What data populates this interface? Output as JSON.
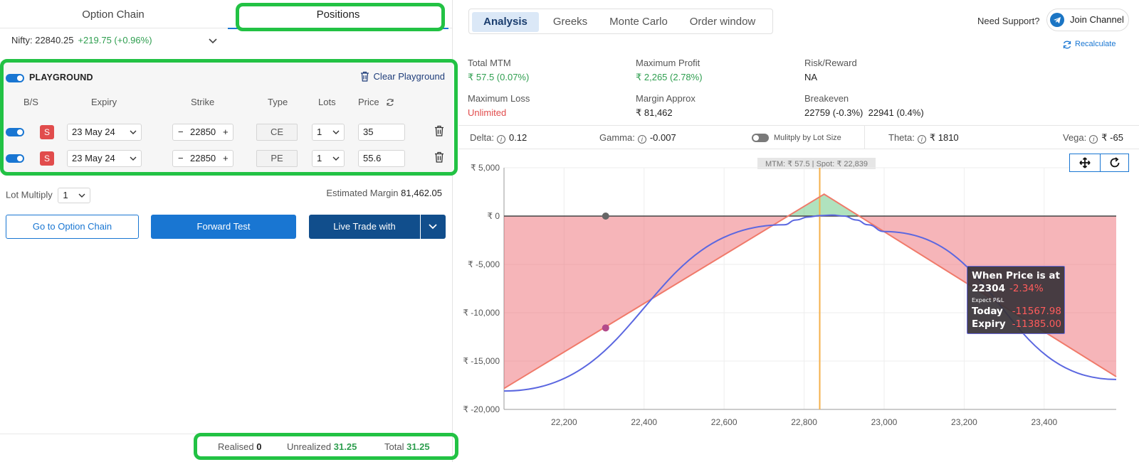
{
  "left_tabs": {
    "option_chain": "Option Chain",
    "positions": "Positions"
  },
  "nifty": {
    "label": "Nifty: 22840.25",
    "change": "+219.75 (+0.96%)"
  },
  "playground": {
    "title": "PLAYGROUND",
    "clear_label": "Clear Playground",
    "headers": {
      "bs": "B/S",
      "expiry": "Expiry",
      "strike": "Strike",
      "type": "Type",
      "lots": "Lots",
      "price": "Price"
    },
    "rows": [
      {
        "side": "S",
        "expiry": "23 May 24",
        "strike": "22850",
        "type": "CE",
        "lots": "1",
        "price": "35"
      },
      {
        "side": "S",
        "expiry": "23 May 24",
        "strike": "22850",
        "type": "PE",
        "lots": "1",
        "price": "55.6"
      }
    ]
  },
  "lot_multiply": {
    "label": "Lot Multiply",
    "value": "1"
  },
  "estimated_margin": {
    "label": "Estimated Margin",
    "value": "81,462.05"
  },
  "buttons": {
    "go_option_chain": "Go to Option Chain",
    "forward_test": "Forward Test",
    "live_trade": "Live Trade with"
  },
  "pnl": {
    "realised_label": "Realised",
    "realised": "0",
    "unrealized_label": "Unrealized",
    "unrealized": "31.25",
    "total_label": "Total",
    "total": "31.25"
  },
  "analysis_tabs": [
    "Analysis",
    "Greeks",
    "Monte Carlo",
    "Order window"
  ],
  "support": {
    "text": "Need Support?",
    "join": "Join Channel",
    "recalculate": "Recalculate"
  },
  "stats": {
    "total_mtm_label": "Total MTM",
    "total_mtm": "₹ 57.5 (0.07%)",
    "max_profit_label": "Maximum Profit",
    "max_profit": "₹ 2,265 (2.78%)",
    "risk_reward_label": "Risk/Reward",
    "risk_reward": "NA",
    "max_loss_label": "Maximum Loss",
    "max_loss": "Unlimited",
    "margin_label": "Margin Approx",
    "margin": "₹ 81,462",
    "breakeven_label": "Breakeven",
    "breakeven": "22759 (-0.3%)  22941 (0.4%)"
  },
  "greeks": {
    "delta_label": "Delta:",
    "delta": "0.12",
    "gamma_label": "Gamma:",
    "gamma": "-0.007",
    "multiply_label": "Mulitply by Lot Size",
    "theta_label": "Theta:",
    "theta": "₹ 1810",
    "vega_label": "Vega:",
    "vega": "₹ -65"
  },
  "colors": {
    "accent": "#1976d2",
    "green": "#2e9e4f",
    "red": "#e14c4c",
    "highlight": "#22c244"
  },
  "chart_data": {
    "type": "area",
    "top_label": "MTM: ₹ 57.5  |  Spot: ₹ 22,839",
    "x_ticks": [
      "22,200",
      "22,400",
      "22,600",
      "22,800",
      "23,000",
      "23,200",
      "23,400"
    ],
    "y_ticks": [
      "₹ 5,000",
      "₹ 0",
      "₹ -5,000",
      "₹ -10,000",
      "₹ -15,000",
      "₹ -20,000"
    ],
    "xlim": [
      22050,
      23580
    ],
    "ylim": [
      -20000,
      5000
    ],
    "spot": 22839,
    "expiry": {
      "x": [
        22050,
        22850,
        23580
      ],
      "y": [
        -17835,
        2265,
        -16615
      ]
    },
    "today": {
      "x": [
        22050,
        22750,
        22780,
        22810,
        22840,
        22870,
        22900,
        22930,
        22960,
        23000,
        23580
      ],
      "y": [
        -18100,
        -900,
        -400,
        -100,
        50,
        100,
        0,
        -400,
        -900,
        -1600,
        -16900
      ]
    },
    "marker_current": {
      "x": 22304,
      "y": 0
    },
    "marker_hover": {
      "x": 22304,
      "y": -11567.98
    },
    "tooltip": {
      "title": "When Price is at",
      "price": "22304",
      "pct": "-2.34%",
      "sub": "Expect P&L",
      "today_label": "Today",
      "today": "-11567.98",
      "expiry_label": "Expiry",
      "expiry": "-11385.00"
    }
  }
}
